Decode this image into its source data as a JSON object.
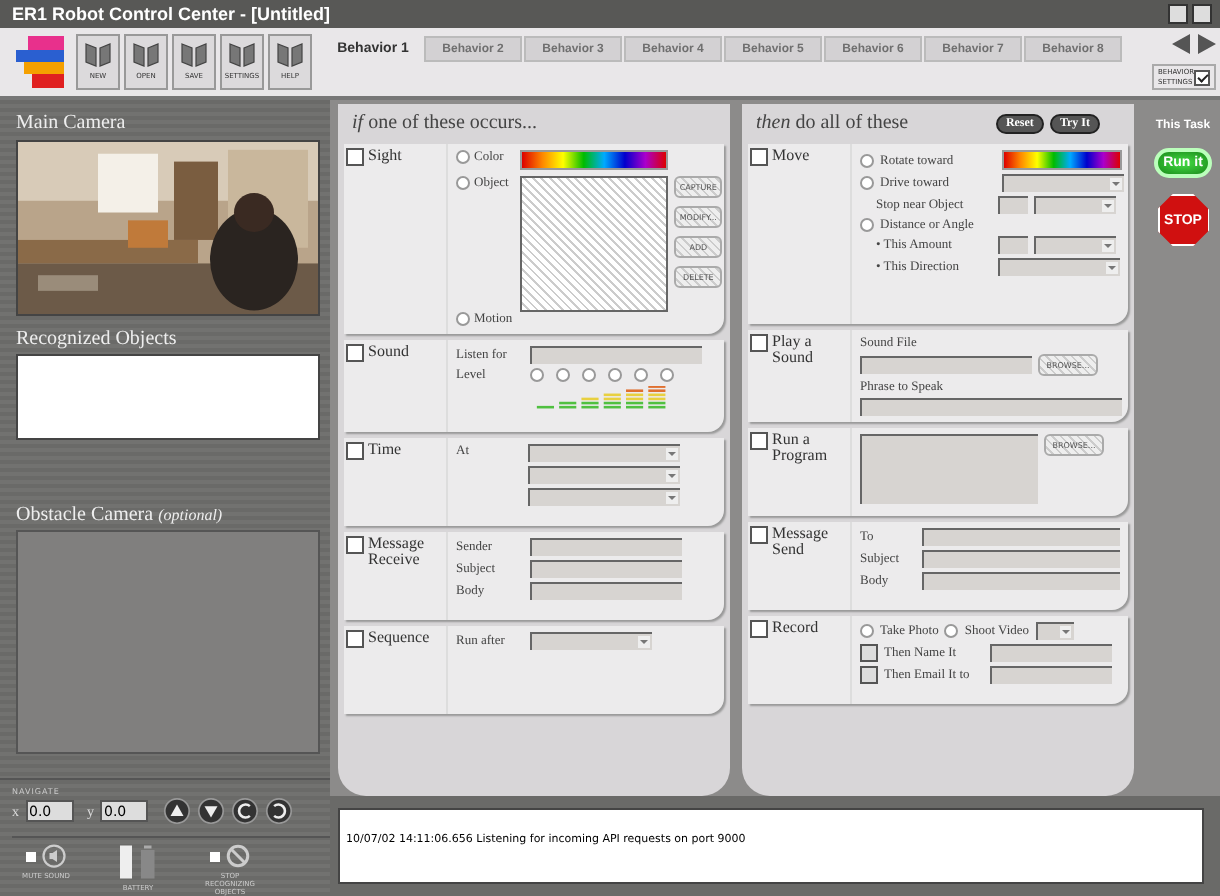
{
  "window": {
    "title": "ER1 Robot Control Center - [Untitled]"
  },
  "toolbar": [
    {
      "label": "NEW"
    },
    {
      "label": "OPEN"
    },
    {
      "label": "SAVE"
    },
    {
      "label": "SETTINGS"
    },
    {
      "label": "HELP"
    }
  ],
  "tabs": [
    {
      "label": "Behavior 1",
      "selected": true
    },
    {
      "label": "Behavior 2",
      "selected": false
    },
    {
      "label": "Behavior 3",
      "selected": false
    },
    {
      "label": "Behavior 4",
      "selected": false
    },
    {
      "label": "Behavior 5",
      "selected": false
    },
    {
      "label": "Behavior 6",
      "selected": false
    },
    {
      "label": "Behavior 7",
      "selected": false
    },
    {
      "label": "Behavior 8",
      "selected": false
    }
  ],
  "behavior_settings": {
    "label": "BEHAVIOR SETTINGS",
    "checked": true
  },
  "left": {
    "main_camera": "Main Camera",
    "recognized_objects": "Recognized Objects",
    "obstacle_camera": "Obstacle Camera",
    "obstacle_note": "(optional)"
  },
  "navigate": {
    "title": "NAVIGATE",
    "x_label": "x",
    "x_value": "0.0",
    "y_label": "y",
    "y_value": "0.0"
  },
  "status": [
    {
      "label": "MUTE SOUND",
      "checked": false
    },
    {
      "label": "BATTERY"
    },
    {
      "label": "STOP RECOGNIZING OBJECTS",
      "checked": false
    }
  ],
  "if_panel": {
    "title": "*if* one of these occurs...",
    "sight": {
      "label": "Sight",
      "checked": false,
      "options": [
        {
          "label": "Color",
          "selected": false
        },
        {
          "label": "Object",
          "selected": false
        },
        {
          "label": "Motion",
          "selected": false
        }
      ],
      "buttons": [
        "CAPTURE",
        "MODIFY...",
        "ADD",
        "DELETE"
      ]
    },
    "sound": {
      "label": "Sound",
      "checked": false,
      "listen_label": "Listen for",
      "level_label": "Level",
      "levels": [
        {
          "selected": false
        },
        {
          "selected": false
        },
        {
          "selected": false
        },
        {
          "selected": false
        },
        {
          "selected": false
        },
        {
          "selected": false
        }
      ]
    },
    "time": {
      "label": "Time",
      "checked": false,
      "at_label": "At"
    },
    "message_receive": {
      "label": "Message Receive",
      "checked": false,
      "fields": [
        "Sender",
        "Subject",
        "Body"
      ]
    },
    "sequence": {
      "label": "Sequence",
      "checked": false,
      "run_after_label": "Run after"
    }
  },
  "then_panel": {
    "title": "*then* do all of these",
    "buttons": [
      "Reset",
      "Try It"
    ],
    "move": {
      "label": "Move",
      "checked": false,
      "options": [
        {
          "label": "Rotate toward",
          "selected": false
        },
        {
          "label": "Drive toward",
          "selected": false
        },
        {
          "label": "Distance or Angle",
          "selected": false
        }
      ],
      "stop_near": "Stop near Object",
      "amount": "• This Amount",
      "direction": "• This Direction"
    },
    "play_sound": {
      "label": "Play a Sound",
      "checked": false,
      "sound_file": "Sound File",
      "browse": "BROWSE...",
      "phrase": "Phrase to Speak"
    },
    "run_program": {
      "label": "Run a Program",
      "checked": false,
      "browse": "BROWSE..."
    },
    "message_send": {
      "label": "Message Send",
      "checked": false,
      "fields": [
        "To",
        "Subject",
        "Body"
      ]
    },
    "record": {
      "label": "Record",
      "checked": false,
      "options": [
        {
          "label": "Take Photo",
          "selected": false
        },
        {
          "label": "Shoot Video",
          "selected": false
        }
      ],
      "checks": [
        {
          "label": "Then Name It",
          "checked": false
        },
        {
          "label": "Then Email It to",
          "checked": false
        }
      ]
    }
  },
  "task": {
    "title": "This Task",
    "run": "Run it",
    "stop": "STOP"
  },
  "log": {
    "text": "10/07/02 14:11:06.656 Listening for incoming API requests on port 9000"
  }
}
